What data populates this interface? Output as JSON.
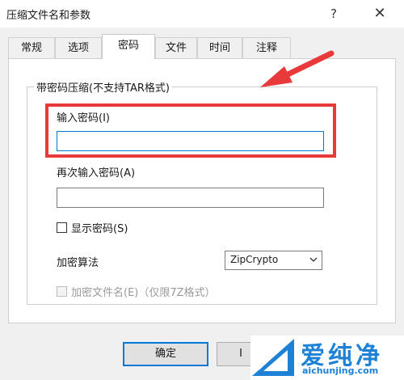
{
  "window": {
    "title": "压缩文件名和参数",
    "help_glyph": "?",
    "close_glyph": "✕"
  },
  "tabs": [
    {
      "label": "常规"
    },
    {
      "label": "选项"
    },
    {
      "label": "密码",
      "active": true
    },
    {
      "label": "文件"
    },
    {
      "label": "时间"
    },
    {
      "label": "注释"
    }
  ],
  "password_group": {
    "title": "带密码压缩(不支持TAR格式)",
    "password_label": "输入密码(I)",
    "password_value": "",
    "confirm_label": "再次输入密码(A)",
    "confirm_value": "",
    "show_password_label": "显示密码(S)",
    "show_password_checked": false,
    "encryption_label": "加密算法",
    "encryption_value": "ZipCrypto",
    "encrypt_names_label": "加密文件名(E)（仅限7Z格式）",
    "encrypt_names_checked": false
  },
  "buttons": {
    "ok": "确定",
    "cancel_partial": "I"
  },
  "watermark": {
    "name": "爱纯净",
    "url": "aichunjing.com"
  },
  "colors": {
    "highlight": "#e8393b",
    "focus": "#0078d7",
    "brand": "#1d82d6"
  }
}
